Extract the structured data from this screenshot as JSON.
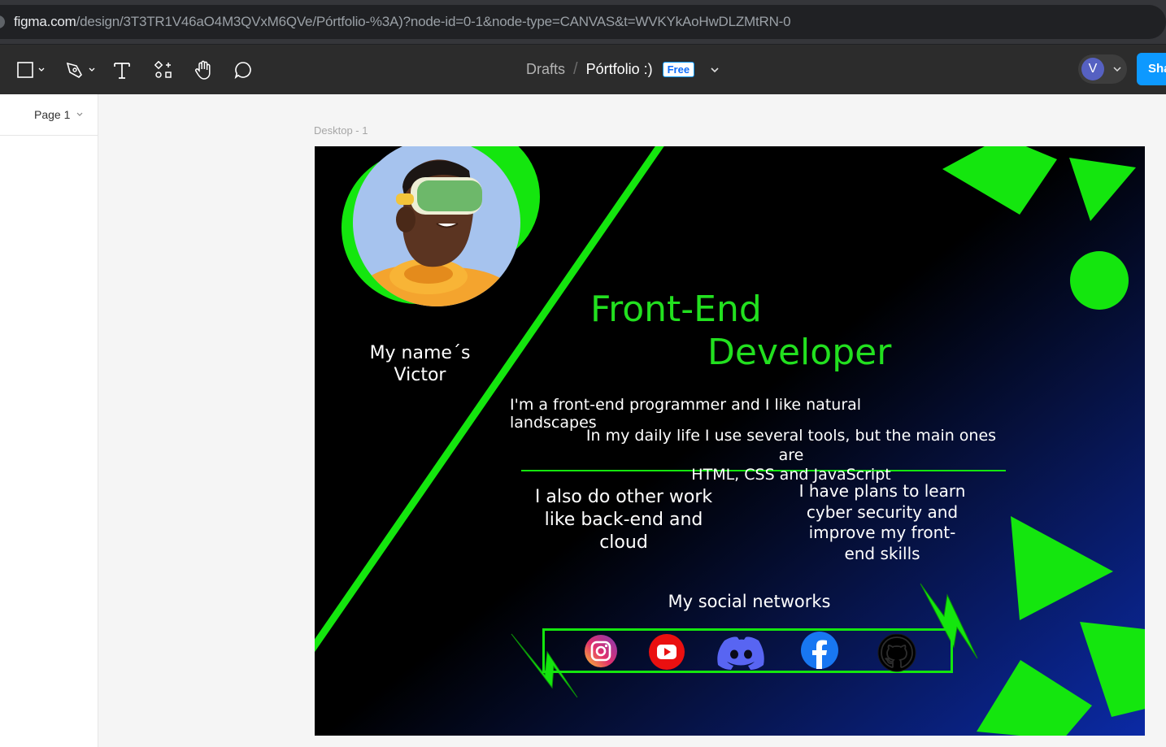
{
  "browser": {
    "url_host": "figma.com",
    "url_path": "/design/3T3TR1V46aO4M3QVxM6QVe/Pórtfolio-%3A)?node-id=0-1&node-type=CANVAS&t=WVKYkAoHwDLZMtRN-0"
  },
  "toolbar": {
    "tools": [
      "frame-tool",
      "pen-tool",
      "text-tool",
      "components-tool",
      "hand-tool",
      "comment-tool"
    ],
    "breadcrumb_drafts": "Drafts",
    "breadcrumb_sep": "/",
    "file_name": "Pórtfolio :)",
    "plan_badge": "Free",
    "avatar_initial": "V",
    "share_label": "Sha"
  },
  "left_panel": {
    "page_label": "Page 1"
  },
  "canvas": {
    "frame_label": "Desktop - 1",
    "frame": {
      "name_line1": "My name´s",
      "name_line2": "Victor",
      "title_line1": "Front-End",
      "title_line2": "Developer",
      "intro": "I'm a front-end programmer and I like natural landscapes",
      "tools_line1": "In my daily life I use several tools, but the main ones are",
      "tools_line2": "HTML, CSS and JavaScript",
      "other_work_line1": "I also do other work",
      "other_work_line2": "like back-end and",
      "other_work_line3": "cloud",
      "plans_line1": "I have plans to learn",
      "plans_line2": "cyber security and",
      "plans_line3": "improve my front-",
      "plans_line4": "end skills",
      "social_heading": "My social networks",
      "social_icons": [
        "instagram-icon",
        "youtube-icon",
        "discord-icon",
        "facebook-icon",
        "github-icon"
      ]
    }
  },
  "colors": {
    "accent_green": "#14e60e",
    "text_green": "#22e01f",
    "figma_blue": "#0d99ff",
    "toolbar_bg": "#2c2c2c"
  }
}
